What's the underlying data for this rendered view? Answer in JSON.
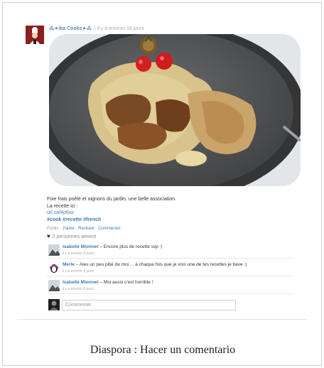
{
  "post": {
    "author": "⁂★ika Cooks★⁂",
    "separator": " – ",
    "time": "il y a environ 18 jours",
    "lines": [
      "Foie frais poêlé et oignons du jardin, une belle association.",
      "La recette ici :"
    ],
    "link": "url.ca/4p6uc",
    "tags": "#cook #recette #french",
    "actions": {
      "visibility": "Public",
      "like": "J'aime",
      "reshare": "Reshare",
      "comment": "Commenter",
      "sep": " · "
    },
    "likes": "2 personnes aiment"
  },
  "comments": [
    {
      "name": "Isabelle Mionnet",
      "text": " – Encore plus de recette svp :)",
      "time": "il y a environ 8 jours"
    },
    {
      "name": "Merle",
      "text": " – Ales un peu pitié de moi ... à chaque fois que je vois une de tes recettes je bave :)",
      "time": "il y a environ 8 jours"
    },
    {
      "name": "Isabelle Mionnet",
      "text": " – Moi aussi c'est horrible !",
      "time": "il y a environ 8 jours"
    }
  ],
  "new_comment": {
    "placeholder": "Commenter"
  },
  "caption": "Diaspora : Hacer un comentario",
  "colors": {
    "link": "#3f79b6",
    "author": "#5d8bbf",
    "avatar_bg": "#8b1e1e"
  },
  "icons": {
    "likes": "heart-icon",
    "author_avatar": "chef-icon"
  }
}
